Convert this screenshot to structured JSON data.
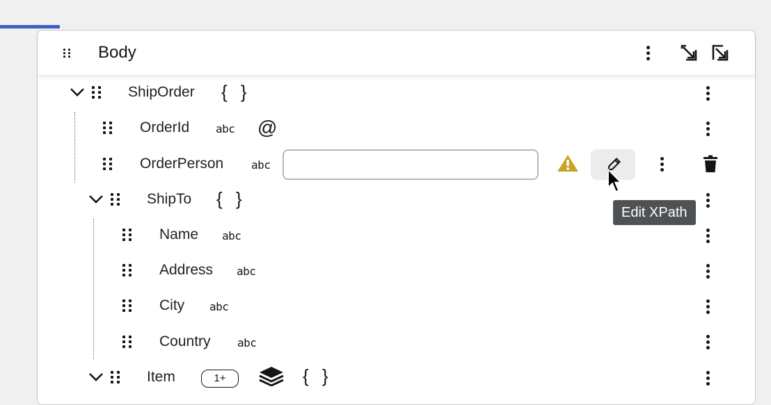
{
  "panel": {
    "title": "Body"
  },
  "tree": {
    "ship_order": {
      "label": "ShipOrder",
      "type_badge": "{ }"
    },
    "order_id": {
      "label": "OrderId",
      "type_badge": "abc",
      "attribute_symbol": "@"
    },
    "order_person": {
      "label": "OrderPerson",
      "type_badge": "abc",
      "xpath_value": ""
    },
    "ship_to": {
      "label": "ShipTo",
      "type_badge": "{ }"
    },
    "name": {
      "label": "Name",
      "type_badge": "abc"
    },
    "address": {
      "label": "Address",
      "type_badge": "abc"
    },
    "city": {
      "label": "City",
      "type_badge": "abc"
    },
    "country": {
      "label": "Country",
      "type_badge": "abc"
    },
    "item": {
      "label": "Item",
      "cardinality": "1+",
      "type_badge": "{ }"
    }
  },
  "tooltip": {
    "text": "Edit XPath"
  },
  "colors": {
    "accent": "#3e5fc9",
    "warning": "#c9a227",
    "tooltip_bg": "#4f5255"
  },
  "icons": [
    "drag-handle-icon",
    "kebab-icon",
    "expand-icon",
    "collapse-icon",
    "chevron-down-icon",
    "warning-icon",
    "pencil-icon",
    "trash-icon",
    "layers-icon",
    "cursor-icon"
  ]
}
